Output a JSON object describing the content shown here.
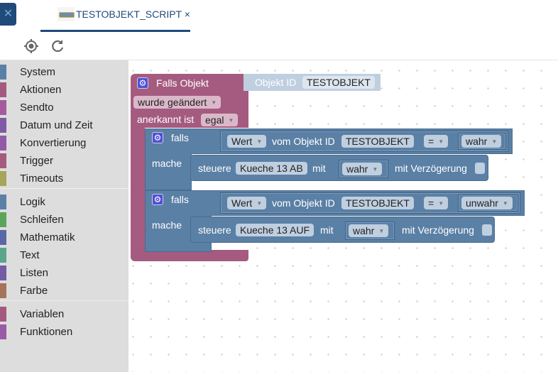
{
  "tab": {
    "close_icon": "close-icon",
    "title": "TESTOBJEKT_SCRIPT",
    "close": "×"
  },
  "toolbar": {
    "locate": "target-icon",
    "refresh": "refresh-icon"
  },
  "sidebar": {
    "items": [
      {
        "label": "System",
        "color": "#5b80a5"
      },
      {
        "label": "Aktionen",
        "color": "#a55b80"
      },
      {
        "label": "Sendto",
        "color": "#a55b9e"
      },
      {
        "label": "Datum und Zeit",
        "color": "#805ba5"
      },
      {
        "label": "Konvertierung",
        "color": "#935ba5"
      },
      {
        "label": "Trigger",
        "color": "#a55b80"
      },
      {
        "label": "Timeouts",
        "color": "#a5a55b"
      },
      {
        "label": "Logik",
        "color": "#5b80a5"
      },
      {
        "label": "Schleifen",
        "color": "#5ba55b"
      },
      {
        "label": "Mathematik",
        "color": "#5b67a5"
      },
      {
        "label": "Text",
        "color": "#5ba58c"
      },
      {
        "label": "Listen",
        "color": "#745ba5"
      },
      {
        "label": "Farbe",
        "color": "#a5745b"
      },
      {
        "label": "Variablen",
        "color": "#a55b80"
      },
      {
        "label": "Funktionen",
        "color": "#995ba5"
      }
    ]
  },
  "blocks": {
    "trigger": {
      "title": "Falls Objekt",
      "objid_label": "Objekt ID",
      "objid": "TESTOBJEKT",
      "event": "wurde geändert",
      "ack_label": "anerkannt ist",
      "ack": "egal"
    },
    "if1": {
      "falls": "falls",
      "mache": "mache",
      "attr": "Wert",
      "vom": "vom Objekt ID",
      "obj": "TESTOBJEKT",
      "op": "=",
      "val": "wahr",
      "steuere": "steuere",
      "target": "Kueche 13 AB",
      "mit": "mit",
      "setval": "wahr",
      "delay": "mit Verzögerung"
    },
    "if2": {
      "falls": "falls",
      "mache": "mache",
      "attr": "Wert",
      "vom": "vom Objekt ID",
      "obj": "TESTOBJEKT",
      "op": "=",
      "val": "unwahr",
      "steuere": "steuere",
      "target": "Kueche 13 AUF",
      "mit": "mit",
      "setval": "wahr",
      "delay": "mit Verzögerung"
    }
  }
}
